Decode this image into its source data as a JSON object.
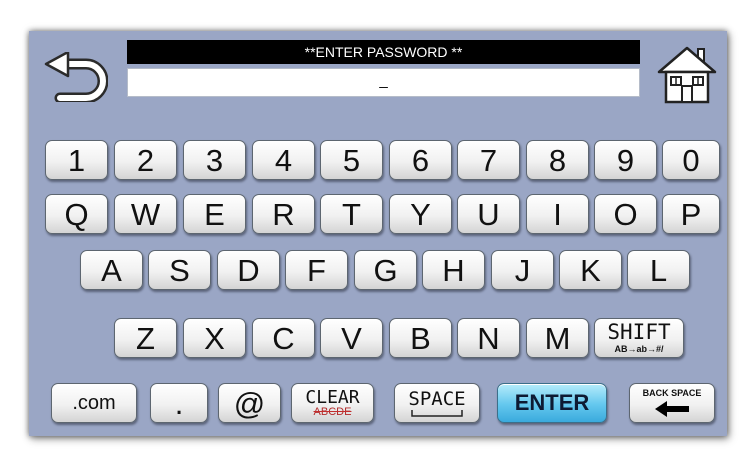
{
  "header": {
    "title": "**ENTER PASSWORD **"
  },
  "password_field": {
    "value": "_"
  },
  "icons": {
    "back": "back-arrow-icon",
    "home": "home-icon"
  },
  "keyboard": {
    "row1": [
      "1",
      "2",
      "3",
      "4",
      "5",
      "6",
      "7",
      "8",
      "9",
      "0"
    ],
    "row2": [
      "Q",
      "W",
      "E",
      "R",
      "T",
      "Y",
      "U",
      "I",
      "O",
      "P"
    ],
    "row3": [
      "A",
      "S",
      "D",
      "F",
      "G",
      "H",
      "J",
      "K",
      "L"
    ],
    "row4": [
      "Z",
      "X",
      "C",
      "V",
      "B",
      "N",
      "M"
    ],
    "shift": {
      "label": "SHIFT",
      "sublabel": "AB→ab→#/"
    },
    "bottom": {
      "com": ".com",
      "dot": ".",
      "at": "@",
      "clear": {
        "label": "CLEAR",
        "sublabel": "ABCDE"
      },
      "space": "SPACE",
      "enter": "ENTER",
      "backspace": "BACK SPACE"
    }
  },
  "colors": {
    "screen_bg": "#9aa6c5",
    "enter_key": "#4bbbe8",
    "titlebar": "#000000"
  }
}
